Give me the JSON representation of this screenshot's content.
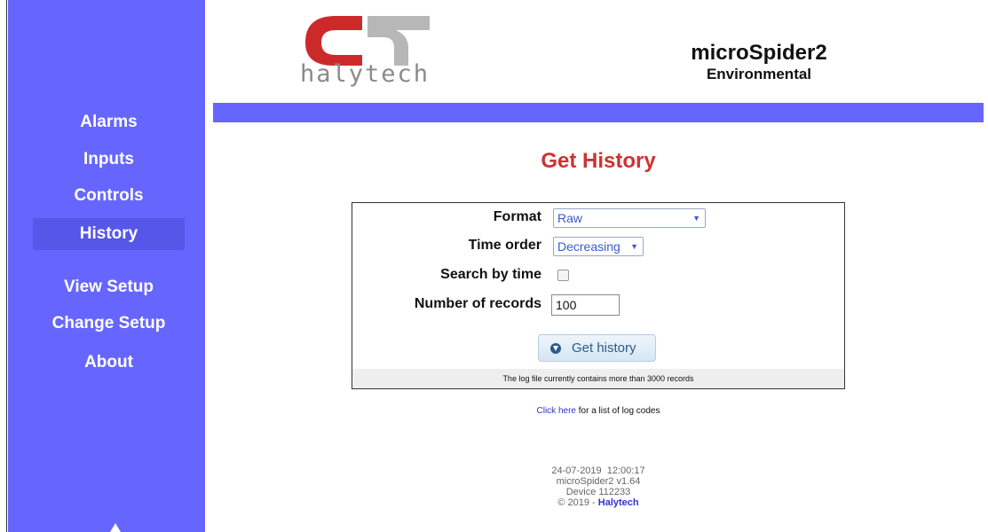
{
  "colors": {
    "sidebar": "#6666ff",
    "accent_red": "#cc3333",
    "link": "#3333cc"
  },
  "brand": {
    "logo_text": "halytech",
    "product": "microSpider2",
    "variant": "Environmental"
  },
  "sidebar": {
    "items": [
      {
        "label": "Alarms",
        "active": false
      },
      {
        "label": "Inputs",
        "active": false
      },
      {
        "label": "Controls",
        "active": false
      },
      {
        "label": "History",
        "active": true
      },
      {
        "label": "View Setup",
        "active": false
      },
      {
        "label": "Change Setup",
        "active": false
      },
      {
        "label": "About",
        "active": false
      }
    ]
  },
  "main": {
    "title": "Get History",
    "form": {
      "format_label": "Format",
      "format_value": "Raw",
      "time_order_label": "Time order",
      "time_order_value": "Decreasing",
      "search_label": "Search by time",
      "search_checked": false,
      "records_label": "Number of records",
      "records_value": "100",
      "button_label": "Get history",
      "info": "The log file currently contains more than 3000 records"
    },
    "log_link": "Click here",
    "log_link_suffix": " for a list of log codes"
  },
  "footer": {
    "datetime": "24-07-2019  12:00:17",
    "version": "microSpider2 v1.64",
    "device": "Device 112233",
    "copyright": "© 2019 - ",
    "brand_link": "Halytech"
  }
}
